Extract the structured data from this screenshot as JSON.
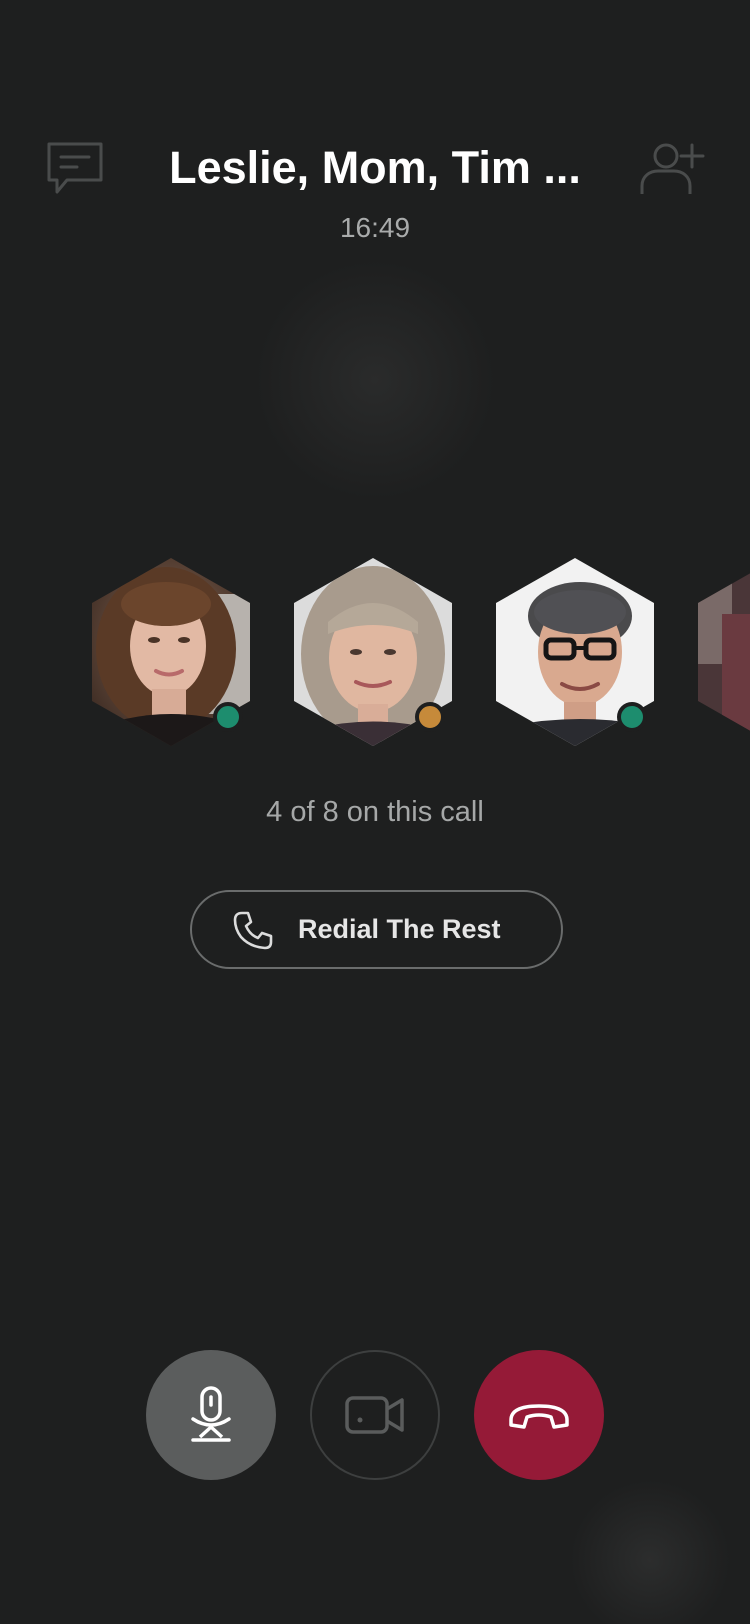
{
  "header": {
    "title": "Leslie, Mom, Tim ...",
    "timer": "16:49",
    "chat_icon": "chat-bubble-icon",
    "add_participant_icon": "add-person-icon"
  },
  "participants": [
    {
      "name": "Leslie",
      "status": "online",
      "status_color": "#1d8d6e"
    },
    {
      "name": "Mom",
      "status": "away",
      "status_color": "#c68a3a"
    },
    {
      "name": "Tim",
      "status": "online",
      "status_color": "#1d8d6e"
    },
    {
      "name": "",
      "status": "",
      "status_color": ""
    }
  ],
  "call_count": "4 of 8 on this call",
  "redial": {
    "label": "Redial The Rest",
    "icon": "phone-icon"
  },
  "controls": {
    "mic_icon": "microphone-icon",
    "video_icon": "video-camera-icon",
    "hangup_icon": "hang-up-icon",
    "hangup_color": "#951a37"
  }
}
